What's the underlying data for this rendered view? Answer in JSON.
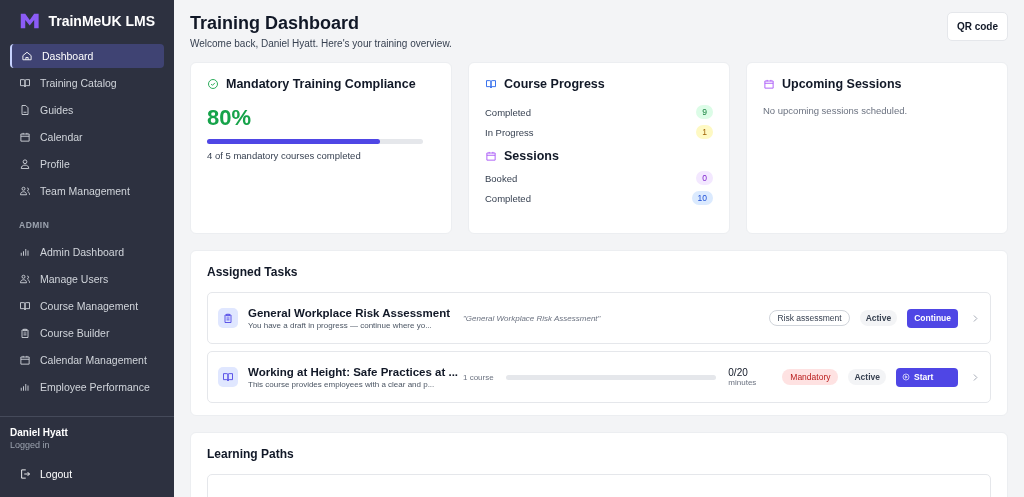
{
  "brand": {
    "name": "TrainMeUK LMS"
  },
  "sidebar": {
    "items": [
      {
        "label": "Dashboard",
        "selected": true
      },
      {
        "label": "Training Catalog",
        "selected": false
      },
      {
        "label": "Guides",
        "selected": false
      },
      {
        "label": "Calendar",
        "selected": false
      },
      {
        "label": "Profile",
        "selected": false
      },
      {
        "label": "Team Management",
        "selected": false
      }
    ],
    "admin_heading": "ADMIN",
    "admin_items": [
      {
        "label": "Admin Dashboard",
        "selected": false
      },
      {
        "label": "Manage Users",
        "selected": false
      },
      {
        "label": "Course Management",
        "selected": false
      },
      {
        "label": "Course Builder",
        "selected": false
      },
      {
        "label": "Calendar Management",
        "selected": false
      },
      {
        "label": "Employee Performance",
        "selected": false
      }
    ],
    "user": {
      "name": "Daniel Hyatt",
      "status": "Logged in"
    },
    "logout": "Logout"
  },
  "header": {
    "title": "Training Dashboard",
    "subtitle": "Welcome back, Daniel Hyatt. Here's your training overview.",
    "button": "QR code"
  },
  "compliance": {
    "title": "Mandatory Training Compliance",
    "percent": "80%",
    "level": 0.8,
    "caption": "4 of 5 mandatory courses completed"
  },
  "course_progress": {
    "title": "Course Progress",
    "rows": [
      {
        "label": "Completed",
        "value": "9"
      },
      {
        "label": "In Progress",
        "value": "1"
      }
    ],
    "sessions_title": "Sessions",
    "sessions": [
      {
        "label": "Booked",
        "value": "0"
      },
      {
        "label": "Completed",
        "value": "10"
      }
    ]
  },
  "upcoming": {
    "title": "Upcoming Sessions",
    "empty": "No upcoming sessions scheduled."
  },
  "tasks": {
    "title": "Assigned Tasks",
    "items": [
      {
        "kind": "draft",
        "title": "General Workplace Risk Assessment",
        "description": "You have a draft in progress — continue where yo...",
        "quote": "\"General Workplace Risk Assessment\"",
        "tag": {
          "label": "Risk assessment",
          "kind": "outline"
        },
        "status": "Active",
        "action": "Continue"
      },
      {
        "kind": "course",
        "title": "Working at Height: Safe Practices at ...",
        "description": "This course provides employees with a clear and p...",
        "count": "1 course",
        "level": 0,
        "progress": "0/20",
        "unit": "minutes",
        "tag": {
          "label": "Mandatory",
          "kind": "danger"
        },
        "status": "Active",
        "action": "Start"
      }
    ]
  },
  "learning_paths": {
    "title": "Learning Paths"
  }
}
